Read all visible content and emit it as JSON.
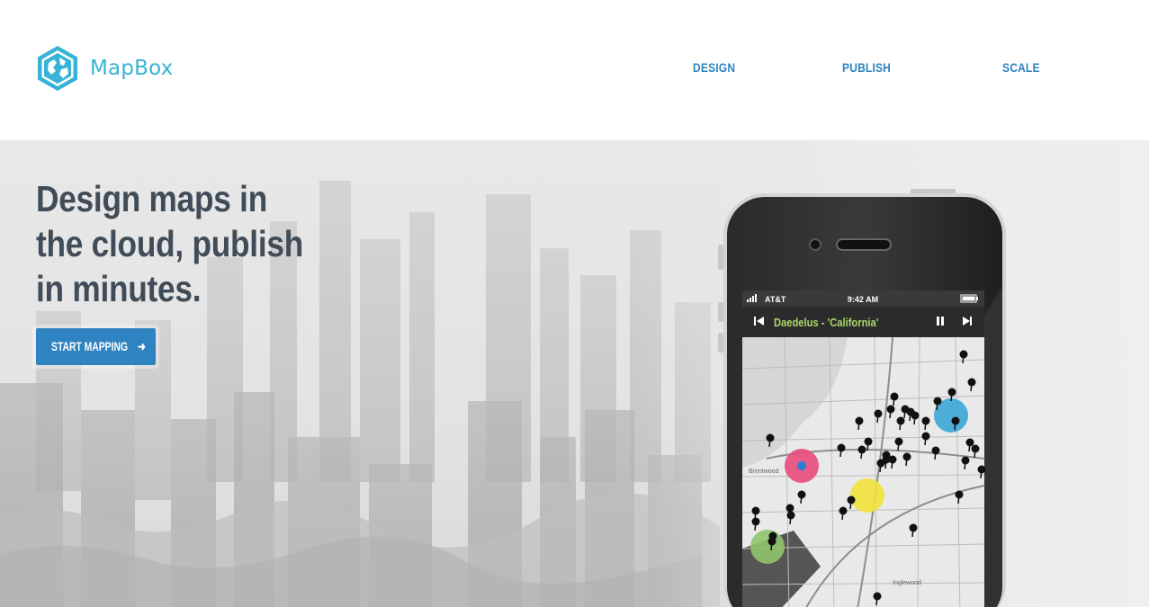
{
  "brand": {
    "name": "MapBox",
    "logo_icon": "mapbox-hexagon-globe",
    "color": "#37b3d6"
  },
  "nav": {
    "items": [
      {
        "label": "DESIGN"
      },
      {
        "label": "PUBLISH"
      },
      {
        "label": "SCALE"
      }
    ],
    "color": "#2f83c0"
  },
  "hero": {
    "headline": "Design maps in the cloud, publish in minutes.",
    "cta_label": "START MAPPING",
    "cta_icon": "arrow-right-icon",
    "cta_color": "#2f83c0"
  },
  "phone": {
    "carrier": "AT&T",
    "time": "9:42 AM",
    "now_playing": "Daedelus - 'California'",
    "map_labels": [
      "Brentwood",
      "Inglewood"
    ],
    "marker_colors": {
      "pink": "#e94b7c",
      "yellow": "#f2e23a",
      "blue": "#3aa6d6",
      "green": "#8fc46c"
    }
  }
}
